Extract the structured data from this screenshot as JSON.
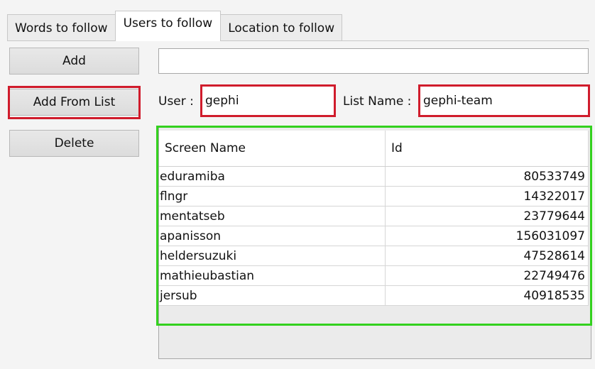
{
  "tabs": [
    {
      "label": "Words to follow"
    },
    {
      "label": "Users to follow"
    },
    {
      "label": "Location to follow"
    }
  ],
  "active_tab": "Users to follow",
  "buttons": {
    "add": "Add",
    "add_from_list": "Add From List",
    "delete": "Delete"
  },
  "add_input": {
    "value": ""
  },
  "user_field": {
    "label": "User :",
    "value": "gephi"
  },
  "list_field": {
    "label": "List Name :",
    "value": "gephi-team"
  },
  "table": {
    "columns": [
      "Screen Name",
      "Id"
    ],
    "rows": [
      {
        "name": "eduramiba",
        "id": "80533749"
      },
      {
        "name": "flngr",
        "id": "14322017"
      },
      {
        "name": "mentatseb",
        "id": "23779644"
      },
      {
        "name": "apanisson",
        "id": "156031097"
      },
      {
        "name": "heldersuzuki",
        "id": "47528614"
      },
      {
        "name": "mathieubastian",
        "id": "22749476"
      },
      {
        "name": "jersub",
        "id": "40918535"
      }
    ]
  },
  "highlight_colors": {
    "red": "#d01c2c",
    "green": "#33d11e"
  }
}
